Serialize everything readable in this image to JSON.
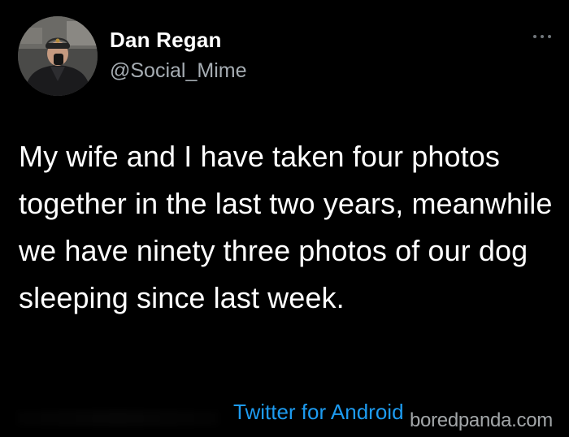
{
  "tweet": {
    "author": {
      "display_name": "Dan Regan",
      "handle": "@Social_Mime",
      "avatar_icon": "user-avatar-photo"
    },
    "more_icon": "more-horizontal-icon",
    "text": "My wife and I have taken four photos together in the last two years, meanwhile we have ninety three photos of our dog sleeping since last week.",
    "source": "Twitter for Android"
  },
  "watermark": "boredpanda.com",
  "colors": {
    "background": "#000000",
    "text": "#ffffff",
    "handle": "#a6adb3",
    "link": "#1d9bf0"
  }
}
